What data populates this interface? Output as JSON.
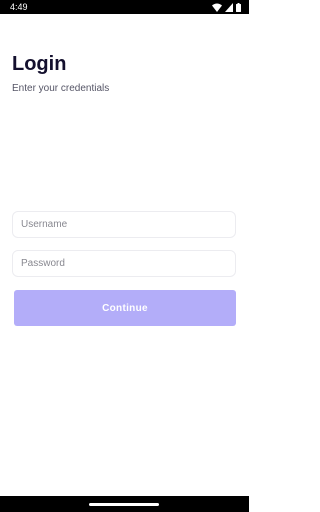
{
  "status_bar": {
    "time": "4:49",
    "icons": [
      "wifi-icon",
      "cellular-signal-icon",
      "battery-icon"
    ]
  },
  "login": {
    "title": "Login",
    "subtitle": "Enter your credentials",
    "username_placeholder": "Username",
    "username_value": "",
    "password_placeholder": "Password",
    "password_value": "",
    "continue_label": "Continue"
  },
  "colors": {
    "status_bar_bg": "#000000",
    "title_text": "#14102e",
    "subtitle_text": "#555566",
    "field_border": "#ececf0",
    "placeholder_text": "#888890",
    "button_bg": "#b3adf9",
    "button_text": "#ffffff",
    "background": "#ffffff"
  }
}
